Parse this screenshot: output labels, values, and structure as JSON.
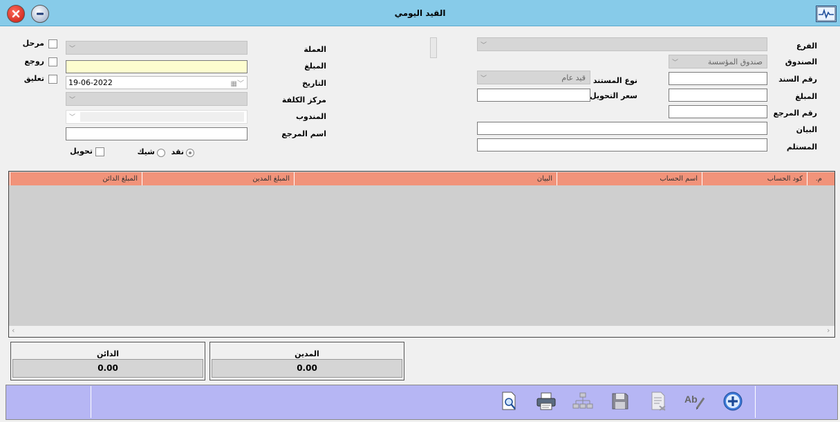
{
  "window": {
    "title": "القيد اليومي"
  },
  "labels": {
    "branch": "الفرع",
    "cashbox": "الصندوق",
    "voucher_no": "رقم السند",
    "doc_type": "نوع المستند",
    "amount_right": "المبلغ",
    "exchange_rate": "سعر التحويل",
    "ref_no": "رقم المرجع",
    "statement": "البيان",
    "receiver": "المستلم",
    "currency": "العملة",
    "amount_left": "المبلغ",
    "date": "التاريخ",
    "cost_center": "مركز الكلفة",
    "delegate": "المندوب",
    "ref_name": "اسم المرجع"
  },
  "fields": {
    "cashbox_value": "صندوق المؤسسة",
    "doc_type_value": "قيد عام",
    "date_value": "19-06-2022"
  },
  "checks": {
    "posted": "مرحل",
    "reviewed": "روجع",
    "suspended": "تعليق",
    "transfer": "تحويل"
  },
  "radios": {
    "cash": "نقد",
    "cheque": "شيك"
  },
  "grid": {
    "columns": [
      "م.",
      "كود الحساب",
      "اسم الحساب",
      "البيان",
      "المبلغ المدين",
      "المبلغ الدائن"
    ]
  },
  "totals": {
    "debit_label": "المدين",
    "debit_value": "0.00",
    "credit_label": "الدائن",
    "credit_value": "0.00"
  },
  "colors": {
    "titlebar": "#87cbe9",
    "grid_header": "#f1937a",
    "toolbar": "#b6b6f4",
    "amount_field": "#fdfdcf"
  },
  "icons": [
    "close-icon",
    "minimize-icon",
    "app-monitor-icon",
    "preview-icon",
    "print-icon",
    "tree-icon",
    "save-icon",
    "document-edit-icon",
    "spellcheck-icon",
    "add-icon"
  ]
}
